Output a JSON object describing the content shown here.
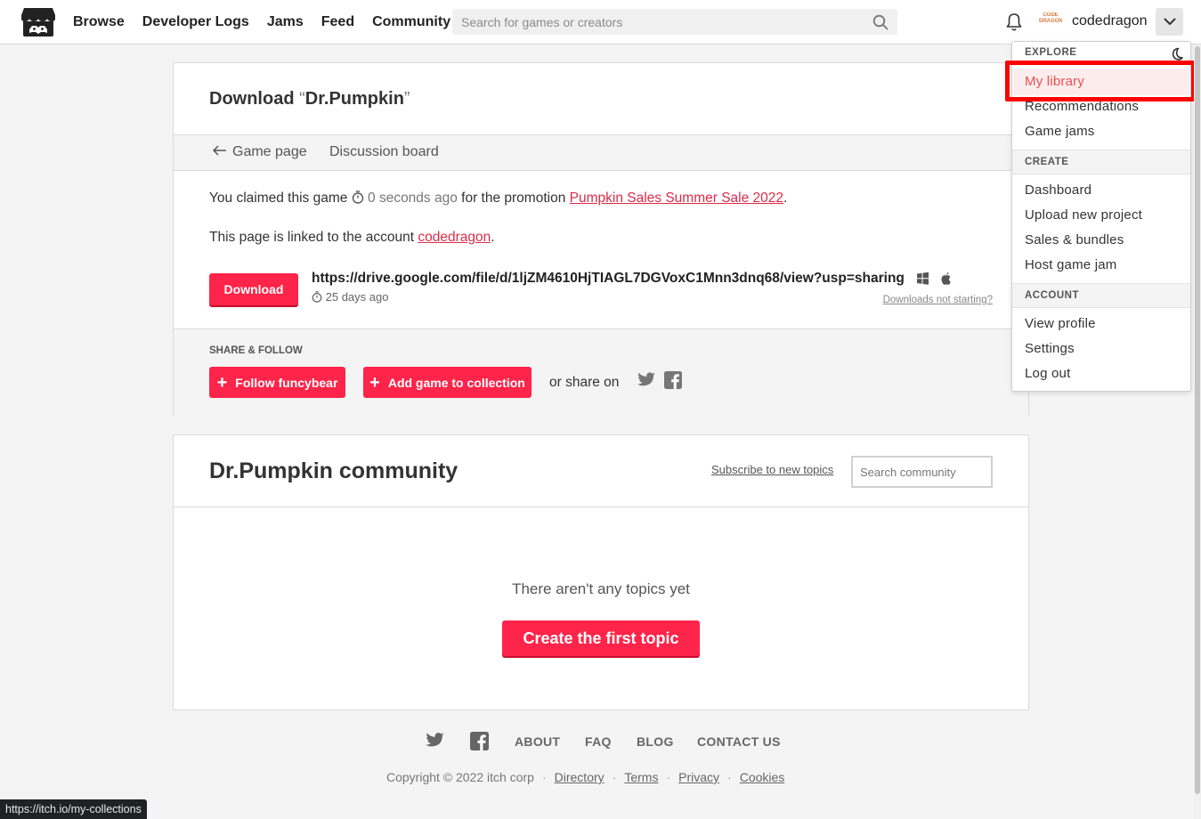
{
  "header": {
    "nav": [
      "Browse",
      "Developer Logs",
      "Jams",
      "Feed",
      "Community"
    ],
    "search_placeholder": "Search for games or creators",
    "avatar_text": "CODE DRAGON",
    "username": "codedragon"
  },
  "dropdown": {
    "explore_heading": "EXPLORE",
    "explore_items": [
      "My library",
      "Recommendations",
      "Game jams"
    ],
    "create_heading": "CREATE",
    "create_items": [
      "Dashboard",
      "Upload new project",
      "Sales & bundles",
      "Host game jam"
    ],
    "account_heading": "ACCOUNT",
    "account_items": [
      "View profile",
      "Settings",
      "Log out"
    ],
    "highlight_color": "#ff0000"
  },
  "download_card": {
    "title_prefix": "Download ",
    "open_quote": "“",
    "game_name": "Dr.Pumpkin",
    "close_quote": "”",
    "game_page_link": "Game page",
    "discussion_link": "Discussion board",
    "claimed_text": "You claimed this game",
    "claimed_ago": "0 seconds ago",
    "promotion_text": "for the promotion",
    "promotion_link": "Pumpkin Sales Summer Sale 2022",
    "period": ".",
    "linked_text": "This page is linked to the account",
    "linked_account": "codedragon",
    "download_button": "Download",
    "download_url": "https://drive.google.com/file/d/1ljZM4610HjTIAGL7DGVoxC1Mnn3dnq68/view?usp=sharing",
    "uploaded_ago": "25 days ago",
    "not_starting": "Downloads not starting?",
    "share_heading": "SHARE & FOLLOW",
    "follow_button": "Follow funcybear",
    "collection_button": "Add game to collection",
    "or_share": "or share on"
  },
  "community_card": {
    "title": "Dr.Pumpkin community",
    "subscribe_link": "Subscribe to new topics",
    "search_placeholder": "Search community",
    "empty_text": "There aren't any topics yet",
    "create_button": "Create the first topic"
  },
  "footer": {
    "links": [
      "ABOUT",
      "FAQ",
      "BLOG",
      "CONTACT US"
    ],
    "copyright": "Copyright © 2022 itch corp",
    "legal": [
      "Directory",
      "Terms",
      "Privacy",
      "Cookies"
    ]
  },
  "status_bar_url": "https://itch.io/my-collections",
  "colors": {
    "accent": "#ff2449",
    "link": "#da2c49"
  }
}
